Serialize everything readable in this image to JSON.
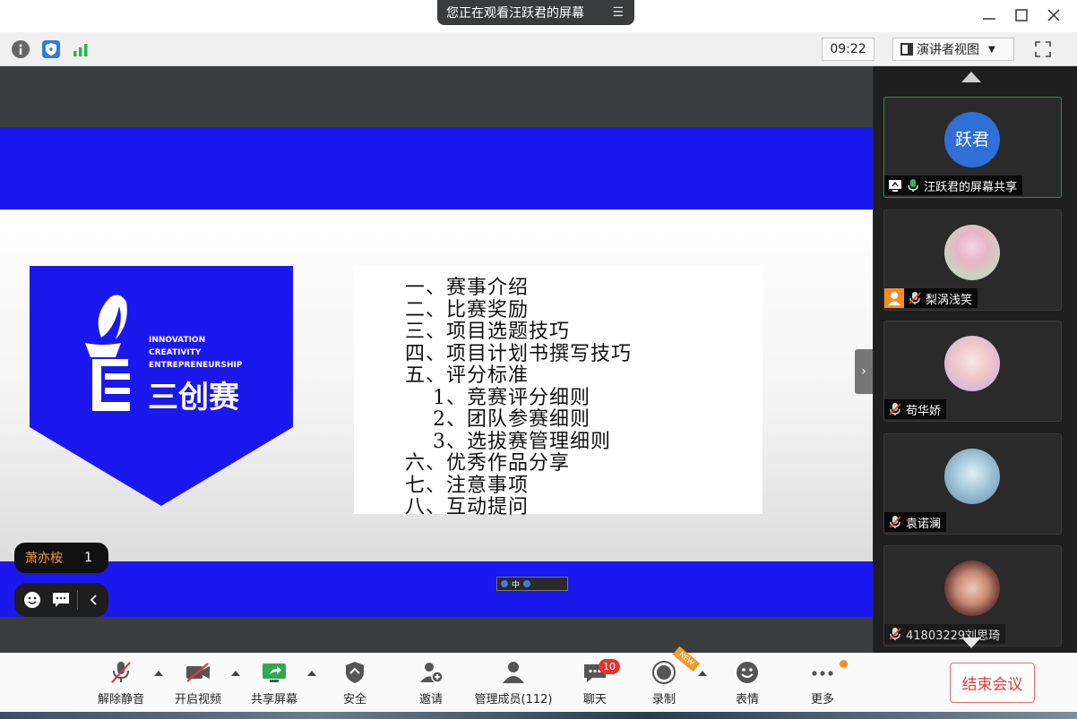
{
  "titlebar": {
    "banner_text": "您正在观看汪跃君的屏幕",
    "banner_menu_icon": "menu-lines-icon",
    "window_controls": [
      "minimize-icon",
      "maximize-icon",
      "close-icon"
    ]
  },
  "toprow": {
    "icons": [
      "info-icon",
      "shield-icon",
      "signal-bars-icon"
    ],
    "time": "09:22",
    "view_mode": "演讲者视图",
    "fullscreen_icon": "fullscreen-icon"
  },
  "slide": {
    "logo_lines": [
      "INNOVATION",
      "CREATIVITY",
      "ENTREPRENEURSHIP"
    ],
    "logo_title": "三创赛",
    "toc": [
      "一、赛事介绍",
      "二、比赛奖励",
      "三、项目选题技巧",
      "四、项目计划书撰写技巧",
      "五、评分标准",
      "1、竞赛评分细则",
      "2、团队参赛细则",
      "3、选拔赛管理细则",
      "六、优秀作品分享",
      "七、注意事项",
      "八、互动提问"
    ],
    "ime_text": "中"
  },
  "speaker": {
    "name": "萧亦桉",
    "count": "1"
  },
  "participants": [
    {
      "avatar_text": "跃君",
      "name": "汪跃君的屏幕共享",
      "mic": "on",
      "sharing": true
    },
    {
      "name": "梨涡浅笑",
      "mic": "muted",
      "has_person_icon": true
    },
    {
      "name": "苟华娇",
      "mic": "muted"
    },
    {
      "name": "袁诺澜",
      "mic": "muted"
    },
    {
      "name": "41803229刘思琦",
      "mic": "muted"
    }
  ],
  "toolbar": {
    "unmute": "解除静音",
    "video": "开启视频",
    "share": "共享屏幕",
    "security": "安全",
    "invite": "邀请",
    "members": "管理成员(112)",
    "chat": "聊天",
    "chat_badge": "10",
    "record": "录制",
    "new_tag": "NEW",
    "reactions": "表情",
    "more": "更多",
    "end_meeting": "结束会议"
  },
  "colors": {
    "slide_blue": "#1b18ee",
    "end_red": "#e0393b",
    "badge_red": "#e6312e",
    "speaking_green": "#2f8a4a"
  }
}
